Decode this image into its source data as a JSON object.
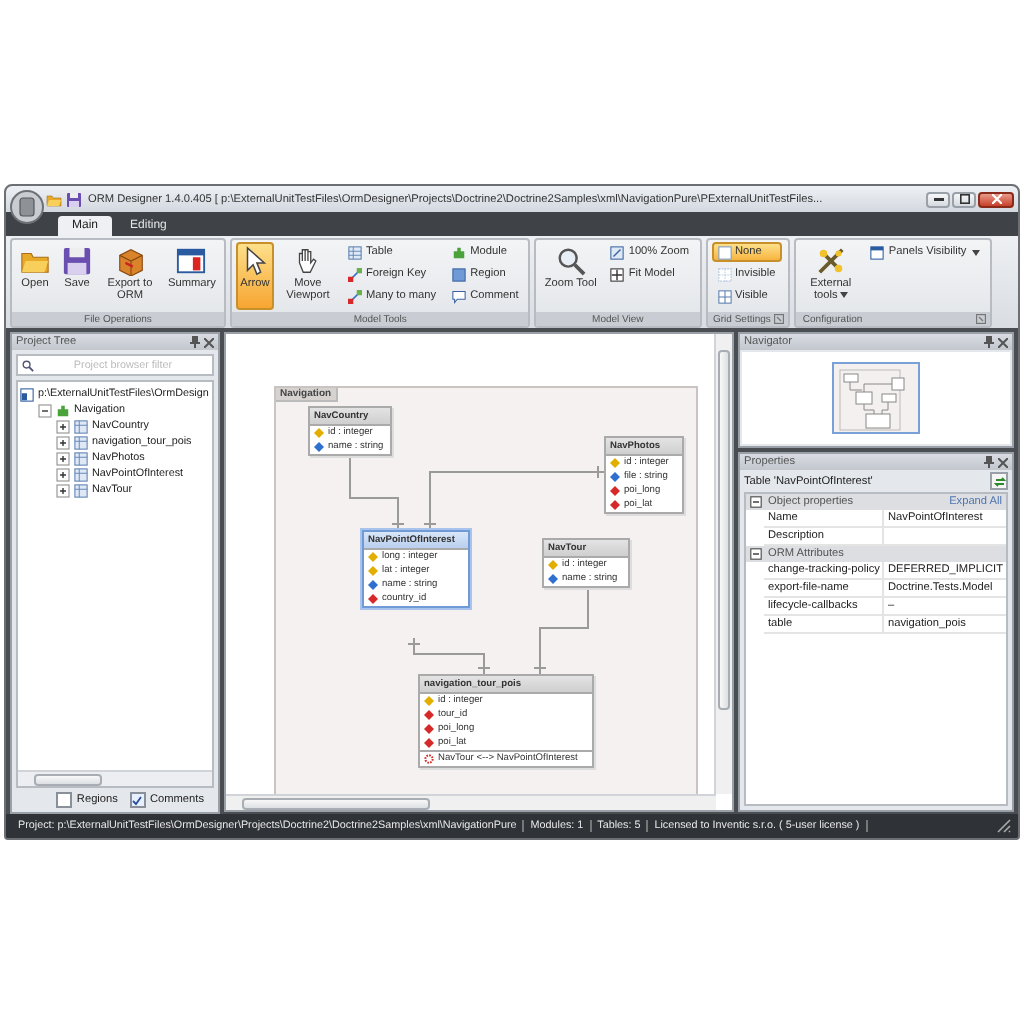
{
  "window": {
    "title": "ORM Designer 1.4.0.405 [ p:\\ExternalUnitTestFiles\\OrmDesigner\\Projects\\Doctrine2\\Doctrine2Samples\\xml\\NavigationPure\\PExternalUnitTestFiles..."
  },
  "ribbon_tabs": [
    {
      "label": "Main",
      "selected": true
    },
    {
      "label": "Editing",
      "selected": false
    }
  ],
  "ribbon_groups": [
    {
      "title": "File Operations",
      "launcher": false,
      "large": [
        {
          "label": "Open"
        },
        {
          "label": "Save"
        },
        {
          "label": "Export to ORM"
        },
        {
          "label": "Summary"
        }
      ]
    },
    {
      "title": "Model Tools",
      "launcher": false,
      "large": [
        {
          "label": "Arrow",
          "selected": true
        },
        {
          "label": "Move Viewport",
          "selected": false
        }
      ],
      "small": [
        {
          "label": "Table"
        },
        {
          "label": "Foreign Key"
        },
        {
          "label": "Many to many"
        },
        {
          "label": "Module"
        },
        {
          "label": "Region"
        },
        {
          "label": "Comment"
        }
      ]
    },
    {
      "title": "Model View",
      "launcher": false,
      "large": [
        {
          "label": "Zoom Tool"
        }
      ],
      "small": [
        {
          "label": "100% Zoom"
        },
        {
          "label": "Fit Model"
        }
      ]
    },
    {
      "title": "Grid Settings",
      "launcher": true,
      "small": [
        {
          "label": "None",
          "selected": true
        },
        {
          "label": "Invisible",
          "selected": false
        },
        {
          "label": "Visible",
          "selected": false
        }
      ]
    },
    {
      "title": "Configuration",
      "launcher": true,
      "large": [
        {
          "label": "External tools",
          "dropdown": true
        }
      ],
      "small": [
        {
          "label": "Panels Visibility",
          "dropdown": true
        }
      ]
    }
  ],
  "project_tree": {
    "title": "Project Tree",
    "filter": {
      "placeholder": "Project browser filter"
    },
    "items": [
      {
        "label": "p:\\ExternalUnitTestFiles\\OrmDesign",
        "children": [
          {
            "label": "Navigation",
            "expanded": true,
            "children": [
              {
                "label": "NavCountry",
                "expanded": false
              },
              {
                "label": "navigation_tour_pois",
                "expanded": false
              },
              {
                "label": "NavPhotos",
                "expanded": false
              },
              {
                "label": "NavPointOfInterest",
                "expanded": false
              },
              {
                "label": "NavTour",
                "expanded": false
              }
            ]
          }
        ]
      }
    ],
    "options": [
      {
        "label": "Regions",
        "checked": false
      },
      {
        "label": "Comments",
        "checked": true
      }
    ]
  },
  "diagram": {
    "module": "Navigation",
    "entities": [
      {
        "name": "NavCountry",
        "selected": false,
        "fields": [
          {
            "kind": "primary",
            "text": "id : integer"
          },
          {
            "kind": "field",
            "text": "name : string"
          }
        ]
      },
      {
        "name": "NavPhotos",
        "selected": false,
        "fields": [
          {
            "kind": "primary",
            "text": "id : integer"
          },
          {
            "kind": "field",
            "text": "file : string"
          },
          {
            "kind": "foreign",
            "text": "poi_long"
          },
          {
            "kind": "foreign",
            "text": "poi_lat"
          }
        ]
      },
      {
        "name": "NavPointOfInterest",
        "selected": true,
        "fields": [
          {
            "kind": "primary",
            "text": "long : integer"
          },
          {
            "kind": "primary",
            "text": "lat : integer"
          },
          {
            "kind": "field",
            "text": "name : string"
          },
          {
            "kind": "foreign",
            "text": "country_id"
          }
        ]
      },
      {
        "name": "NavTour",
        "selected": false,
        "fields": [
          {
            "kind": "primary",
            "text": "id : integer"
          },
          {
            "kind": "field",
            "text": "name : string"
          }
        ]
      },
      {
        "name": "navigation_tour_pois",
        "selected": false,
        "fields": [
          {
            "kind": "primary",
            "text": "id : integer"
          },
          {
            "kind": "foreign",
            "text": "tour_id"
          },
          {
            "kind": "foreign",
            "text": "poi_long"
          },
          {
            "kind": "foreign",
            "text": "poi_lat"
          },
          {
            "kind": "relation",
            "text": "NavTour <--> NavPointOfInterest"
          }
        ]
      }
    ]
  },
  "navigator": {
    "title": "Navigator"
  },
  "properties": {
    "title": "Properties",
    "subject": "Table 'NavPointOfInterest'",
    "sections": [
      {
        "title": "Object properties",
        "expanded": true,
        "link": "Expand All",
        "rows": [
          {
            "name": "Name",
            "value": "NavPointOfInterest"
          },
          {
            "name": "Description"
          }
        ]
      },
      {
        "title": "ORM Attributes",
        "expanded": true,
        "rows": [
          {
            "name": "change-tracking-policy",
            "value": "DEFERRED_IMPLICIT"
          },
          {
            "name": "export-file-name",
            "value": "Doctrine.Tests.Model"
          },
          {
            "name": "lifecycle-callbacks",
            "value": "–"
          },
          {
            "name": "table",
            "value": "navigation_pois"
          }
        ]
      }
    ]
  },
  "status_bar": [
    "Project: p:\\ExternalUnitTestFiles\\OrmDesigner\\Projects\\Doctrine2\\Doctrine2Samples\\xml\\NavigationPure",
    "Modules: 1",
    "Tables: 5",
    "Licensed to Inventic s.r.o. ( 5-user license )"
  ]
}
